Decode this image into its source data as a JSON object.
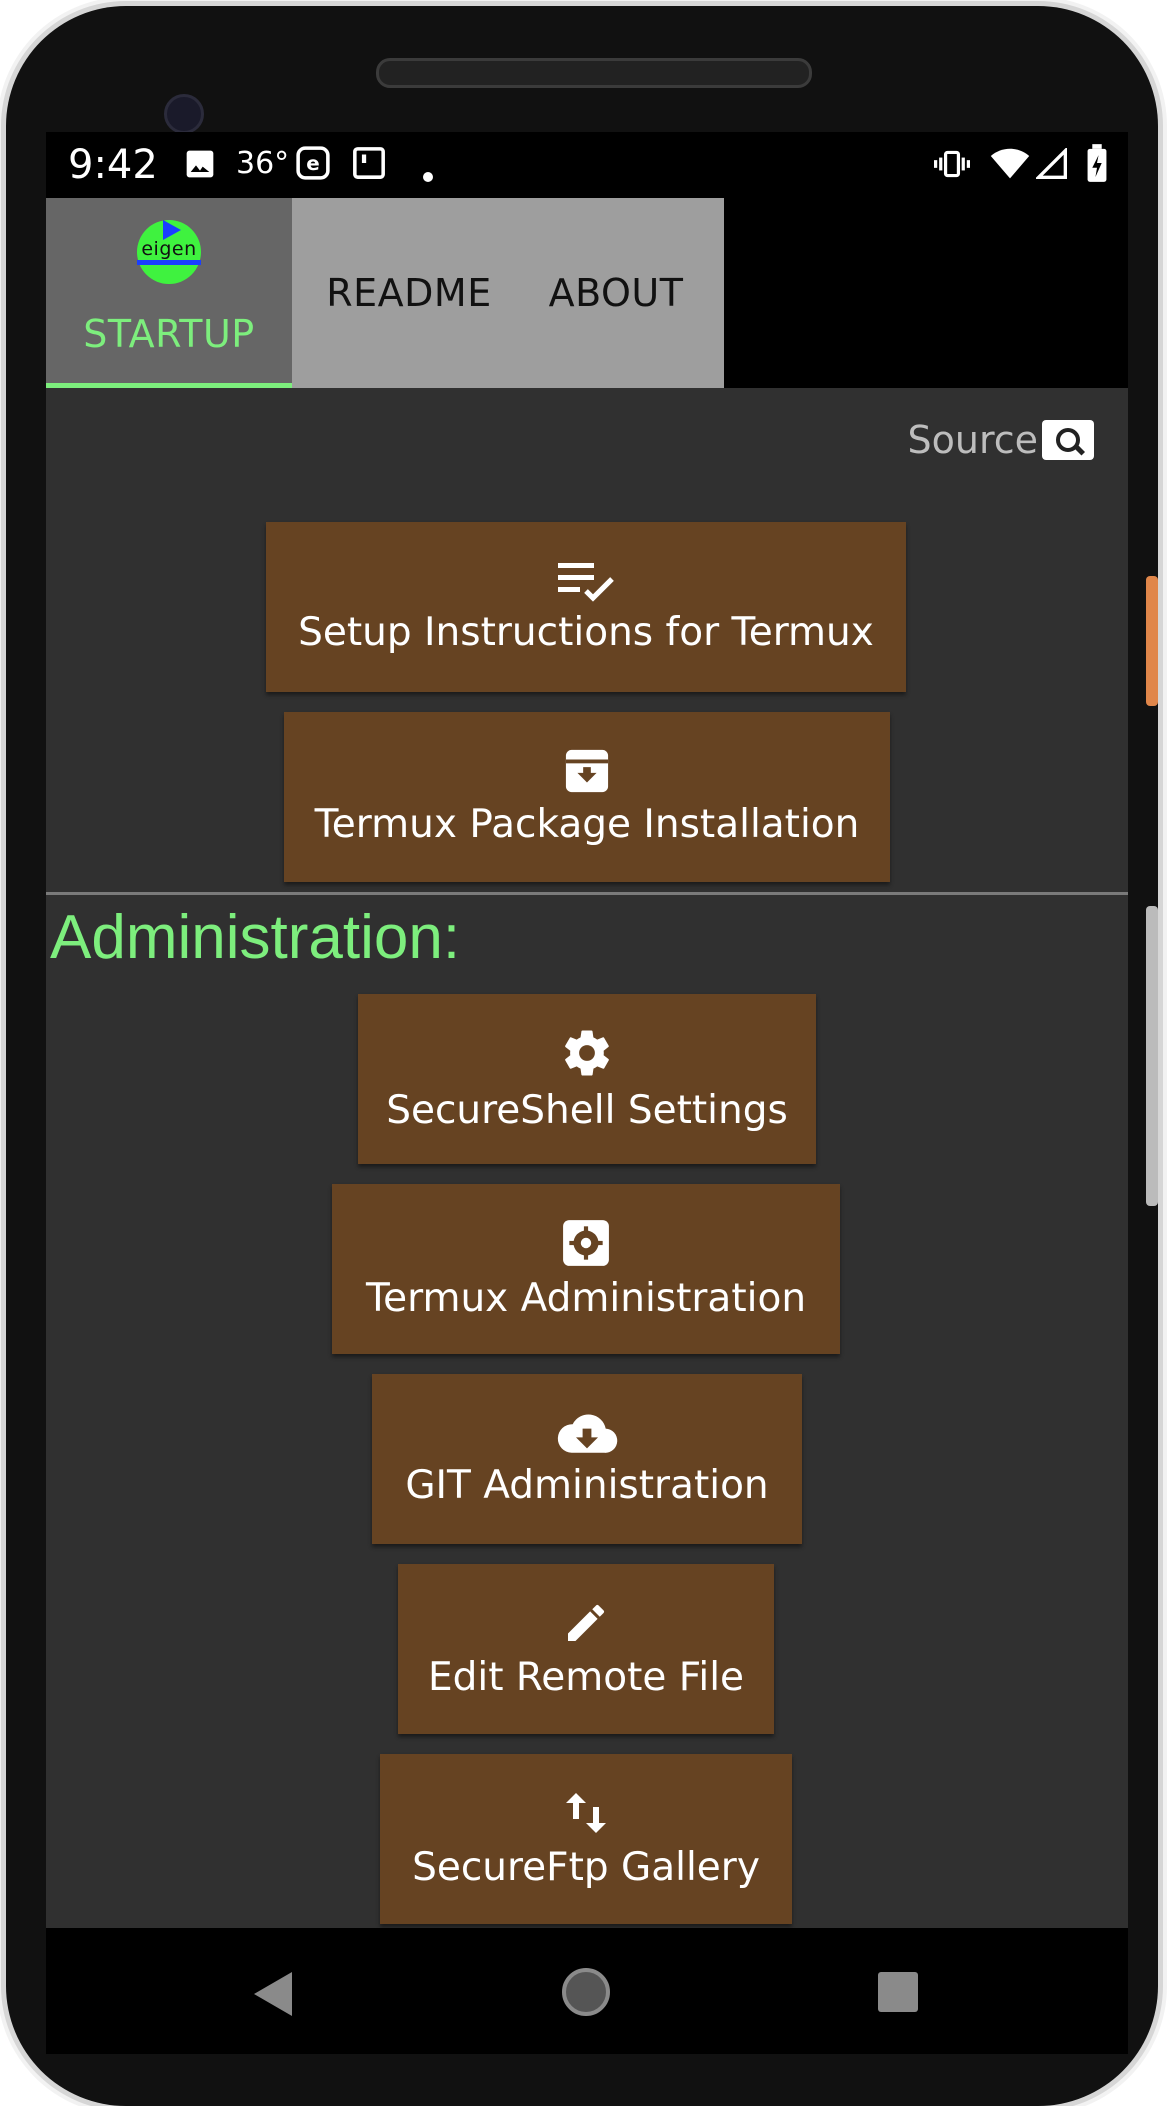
{
  "status_bar": {
    "time": "9:42",
    "temperature": "36°",
    "icons_left": [
      "image-icon",
      "e-app-icon",
      "sd-card-icon",
      "dot-icon"
    ],
    "icons_right": [
      "vibrate-icon",
      "wifi-icon",
      "signal-icon",
      "battery-icon"
    ]
  },
  "tabs": [
    {
      "label": "STARTUP",
      "selected": true
    },
    {
      "label": "README",
      "selected": false
    },
    {
      "label": "ABOUT",
      "selected": false
    }
  ],
  "logo": {
    "text": "eigen"
  },
  "source": {
    "label": "Source"
  },
  "setup_buttons": [
    {
      "label": "Setup Instructions for Termux",
      "icon": "checklist-icon"
    },
    {
      "label": "Termux Package Installation",
      "icon": "archive-download-icon"
    }
  ],
  "admin_section": {
    "heading": "Administration:",
    "buttons": [
      {
        "label": "SecureShell Settings",
        "icon": "gear-icon"
      },
      {
        "label": "Termux Administration",
        "icon": "settings-box-icon"
      },
      {
        "label": "GIT Administration",
        "icon": "cloud-download-icon"
      },
      {
        "label": "Edit Remote File",
        "icon": "pencil-icon"
      },
      {
        "label": "SecureFtp Gallery",
        "icon": "swap-vertical-icon"
      }
    ]
  },
  "colors": {
    "button_bg": "#664322",
    "accent_green": "#7dee7d",
    "content_bg": "#303030"
  }
}
